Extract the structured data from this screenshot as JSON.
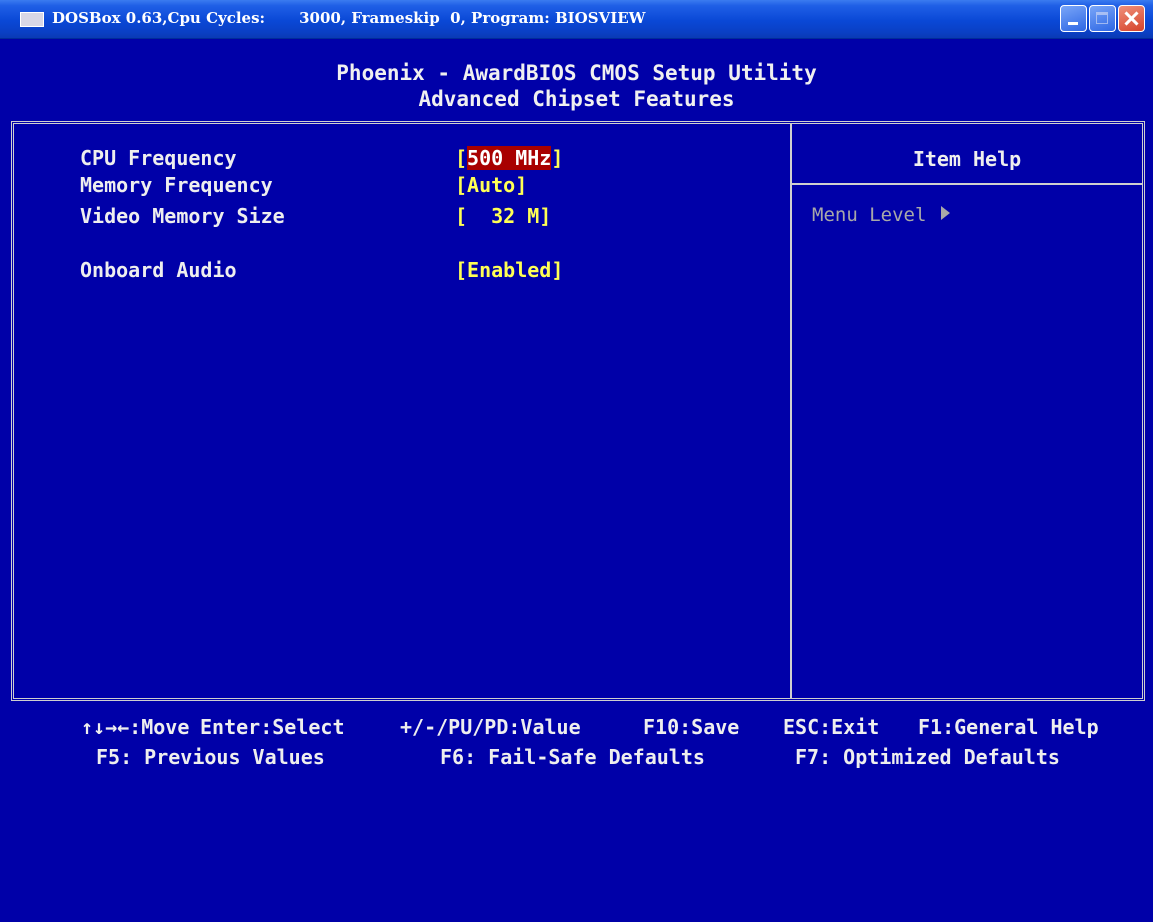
{
  "window": {
    "title_left": "DOSBox 0.63,Cpu Cycles:",
    "title_right": "3000, Frameskip  0, Program: BIOSVIEW",
    "controls": [
      "minimize-icon",
      "maximize-icon",
      "close-icon"
    ]
  },
  "header": {
    "title": "Phoenix - AwardBIOS CMOS Setup Utility",
    "subtitle": "Advanced Chipset Features"
  },
  "settings": [
    {
      "label": "CPU Frequency",
      "value": "500 MHz",
      "selected": true
    },
    {
      "label": "Memory Frequency",
      "value": "[Auto]"
    },
    {
      "label": "Video Memory Size",
      "value": "[  32 M]"
    },
    {
      "label": "Onboard Audio",
      "value": "[Enabled]"
    }
  ],
  "help": {
    "title": "Item Help",
    "menu_level": "Menu Level"
  },
  "footer": {
    "row1": [
      "↑↓→←:Move",
      "Enter:Select",
      "+/-/PU/PD:Value",
      "F10:Save",
      "ESC:Exit",
      "F1:General Help"
    ],
    "row2": [
      "F5: Previous Values",
      "F6: Fail-Safe Defaults",
      "F7: Optimized Defaults"
    ]
  },
  "colors": {
    "background": "#0000a8",
    "value": "#ffff54",
    "selection": "#a80000",
    "text": "#eeeeee"
  }
}
